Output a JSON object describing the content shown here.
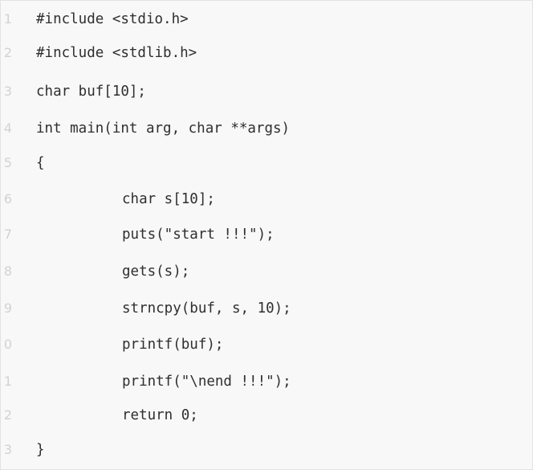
{
  "code_view": {
    "lines": [
      {
        "number": "1",
        "code": "#include <stdio.h>"
      },
      {
        "number": "2",
        "code": "#include <stdlib.h>"
      },
      {
        "number": "3",
        "code": "char buf[10];"
      },
      {
        "number": "4",
        "code": "int main(int arg, char **args)"
      },
      {
        "number": "5",
        "code": "{"
      },
      {
        "number": "6",
        "code": "char s[10];"
      },
      {
        "number": "7",
        "code": "puts(\"start !!!\");"
      },
      {
        "number": "8",
        "code": "gets(s);"
      },
      {
        "number": "9",
        "code": "strncpy(buf, s, 10);"
      },
      {
        "number": "0",
        "code": "printf(buf);"
      },
      {
        "number": "1",
        "code": "printf(\"\\nend !!!\");"
      },
      {
        "number": "2",
        "code": "return 0;"
      },
      {
        "number": "3",
        "code": "}"
      }
    ]
  }
}
